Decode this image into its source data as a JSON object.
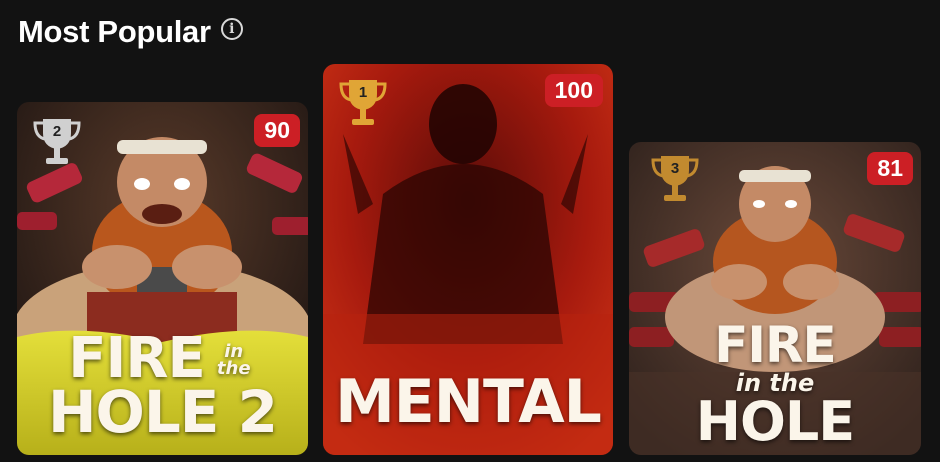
{
  "section": {
    "title": "Most Popular",
    "info_icon_glyph": "i"
  },
  "cards": [
    {
      "rank": "2",
      "score": "90",
      "title_line1": "FIRE",
      "title_small": "in the",
      "title_line2": "HOLE 2",
      "trophy_color": "#c9c9c9"
    },
    {
      "rank": "1",
      "score": "100",
      "title": "MENTAL",
      "trophy_color": "#d99a2b"
    },
    {
      "rank": "3",
      "score": "81",
      "title_line1": "FIRE",
      "title_small": "in the",
      "title_line2": "HOLE",
      "trophy_color": "#c58a2e"
    }
  ],
  "colors": {
    "background": "#121212",
    "badge": "#cc1f25",
    "accent_yellow": "#d6d22a",
    "mental_red": "#c62814"
  }
}
